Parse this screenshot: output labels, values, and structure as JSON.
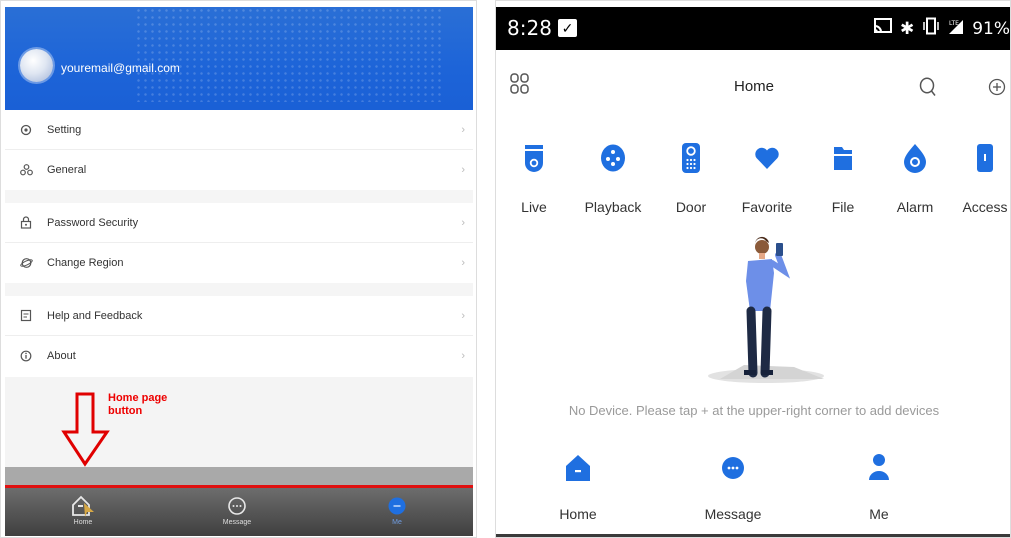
{
  "left": {
    "account": {
      "email": "youremail@gmail.com"
    },
    "menu": [
      {
        "label": "Setting",
        "icon": "settings-icon"
      },
      {
        "label": "General",
        "icon": "general-icon"
      },
      {
        "label": "Password Security",
        "icon": "lock-icon"
      },
      {
        "label": "Change Region",
        "icon": "region-icon"
      },
      {
        "label": "Help and Feedback",
        "icon": "help-icon"
      },
      {
        "label": "About",
        "icon": "info-icon"
      }
    ],
    "annotation": {
      "line1": "Home page",
      "line2": "button"
    },
    "nav": {
      "home": "Home",
      "message": "Message",
      "me": "Me"
    },
    "colors": {
      "header": "#1d64d8",
      "annotation": "#e00000"
    }
  },
  "right": {
    "status": {
      "time": "8:28",
      "battery": "91%"
    },
    "header": {
      "title": "Home"
    },
    "categories": [
      {
        "label": "Live",
        "icon": "camera-icon"
      },
      {
        "label": "Playback",
        "icon": "playback-icon"
      },
      {
        "label": "Door",
        "icon": "door-icon"
      },
      {
        "label": "Favorite",
        "icon": "heart-icon"
      },
      {
        "label": "File",
        "icon": "folder-icon"
      },
      {
        "label": "Alarm",
        "icon": "alarm-icon"
      },
      {
        "label": "Access",
        "icon": "access-icon"
      }
    ],
    "empty_message": "No Device. Please tap + at the upper-right corner to add devices",
    "nav": {
      "home": "Home",
      "message": "Message",
      "me": "Me"
    },
    "colors": {
      "accent": "#1f6fe0"
    }
  }
}
